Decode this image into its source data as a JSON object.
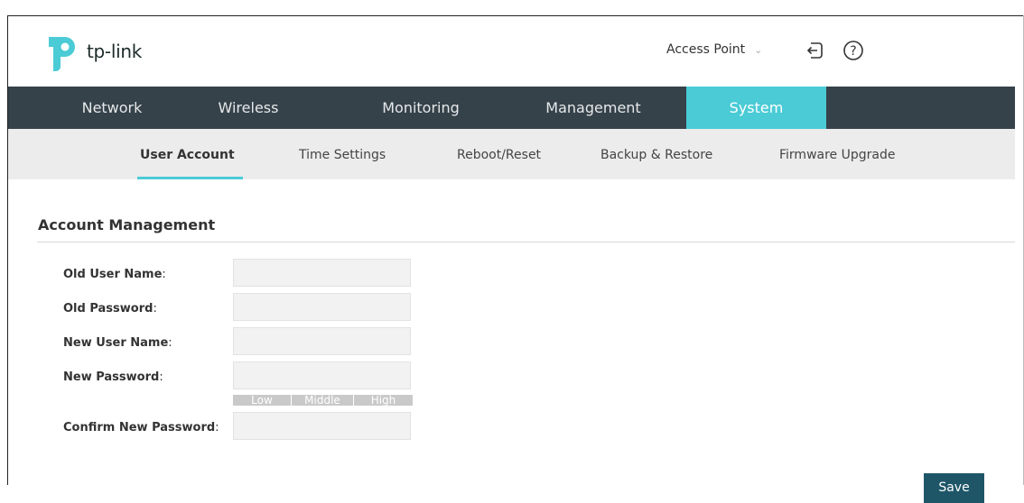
{
  "brand": {
    "name": "tp-link"
  },
  "header": {
    "mode_label": "Access Point",
    "mode_caret": "⌄",
    "logout_icon": "logout-icon",
    "help_icon": "help-icon"
  },
  "main_nav": {
    "items": [
      {
        "label": "Network"
      },
      {
        "label": "Wireless"
      },
      {
        "label": "Monitoring"
      },
      {
        "label": "Management"
      },
      {
        "label": "System",
        "active": true
      }
    ]
  },
  "sub_nav": {
    "items": [
      {
        "label": "User Account",
        "active": true
      },
      {
        "label": "Time Settings"
      },
      {
        "label": "Reboot/Reset"
      },
      {
        "label": "Backup & Restore"
      },
      {
        "label": "Firmware Upgrade"
      }
    ]
  },
  "account_management": {
    "title": "Account Management",
    "fields": [
      {
        "label": "Old User Name",
        "value": ""
      },
      {
        "label": "Old Password",
        "value": ""
      },
      {
        "label": "New User Name",
        "value": ""
      },
      {
        "label": "New Password",
        "value": ""
      },
      {
        "label": "Confirm New Password",
        "value": ""
      }
    ],
    "colon": ":",
    "strength": {
      "low": "Low",
      "middle": "Middle",
      "high": "High"
    }
  },
  "actions": {
    "save_label": "Save"
  },
  "colors": {
    "nav_bg": "#36424a",
    "nav_active": "#4acbd6",
    "subnav_bg": "#ececec",
    "save_bg": "#1e5668",
    "logo_blue": "#4acbd6"
  }
}
